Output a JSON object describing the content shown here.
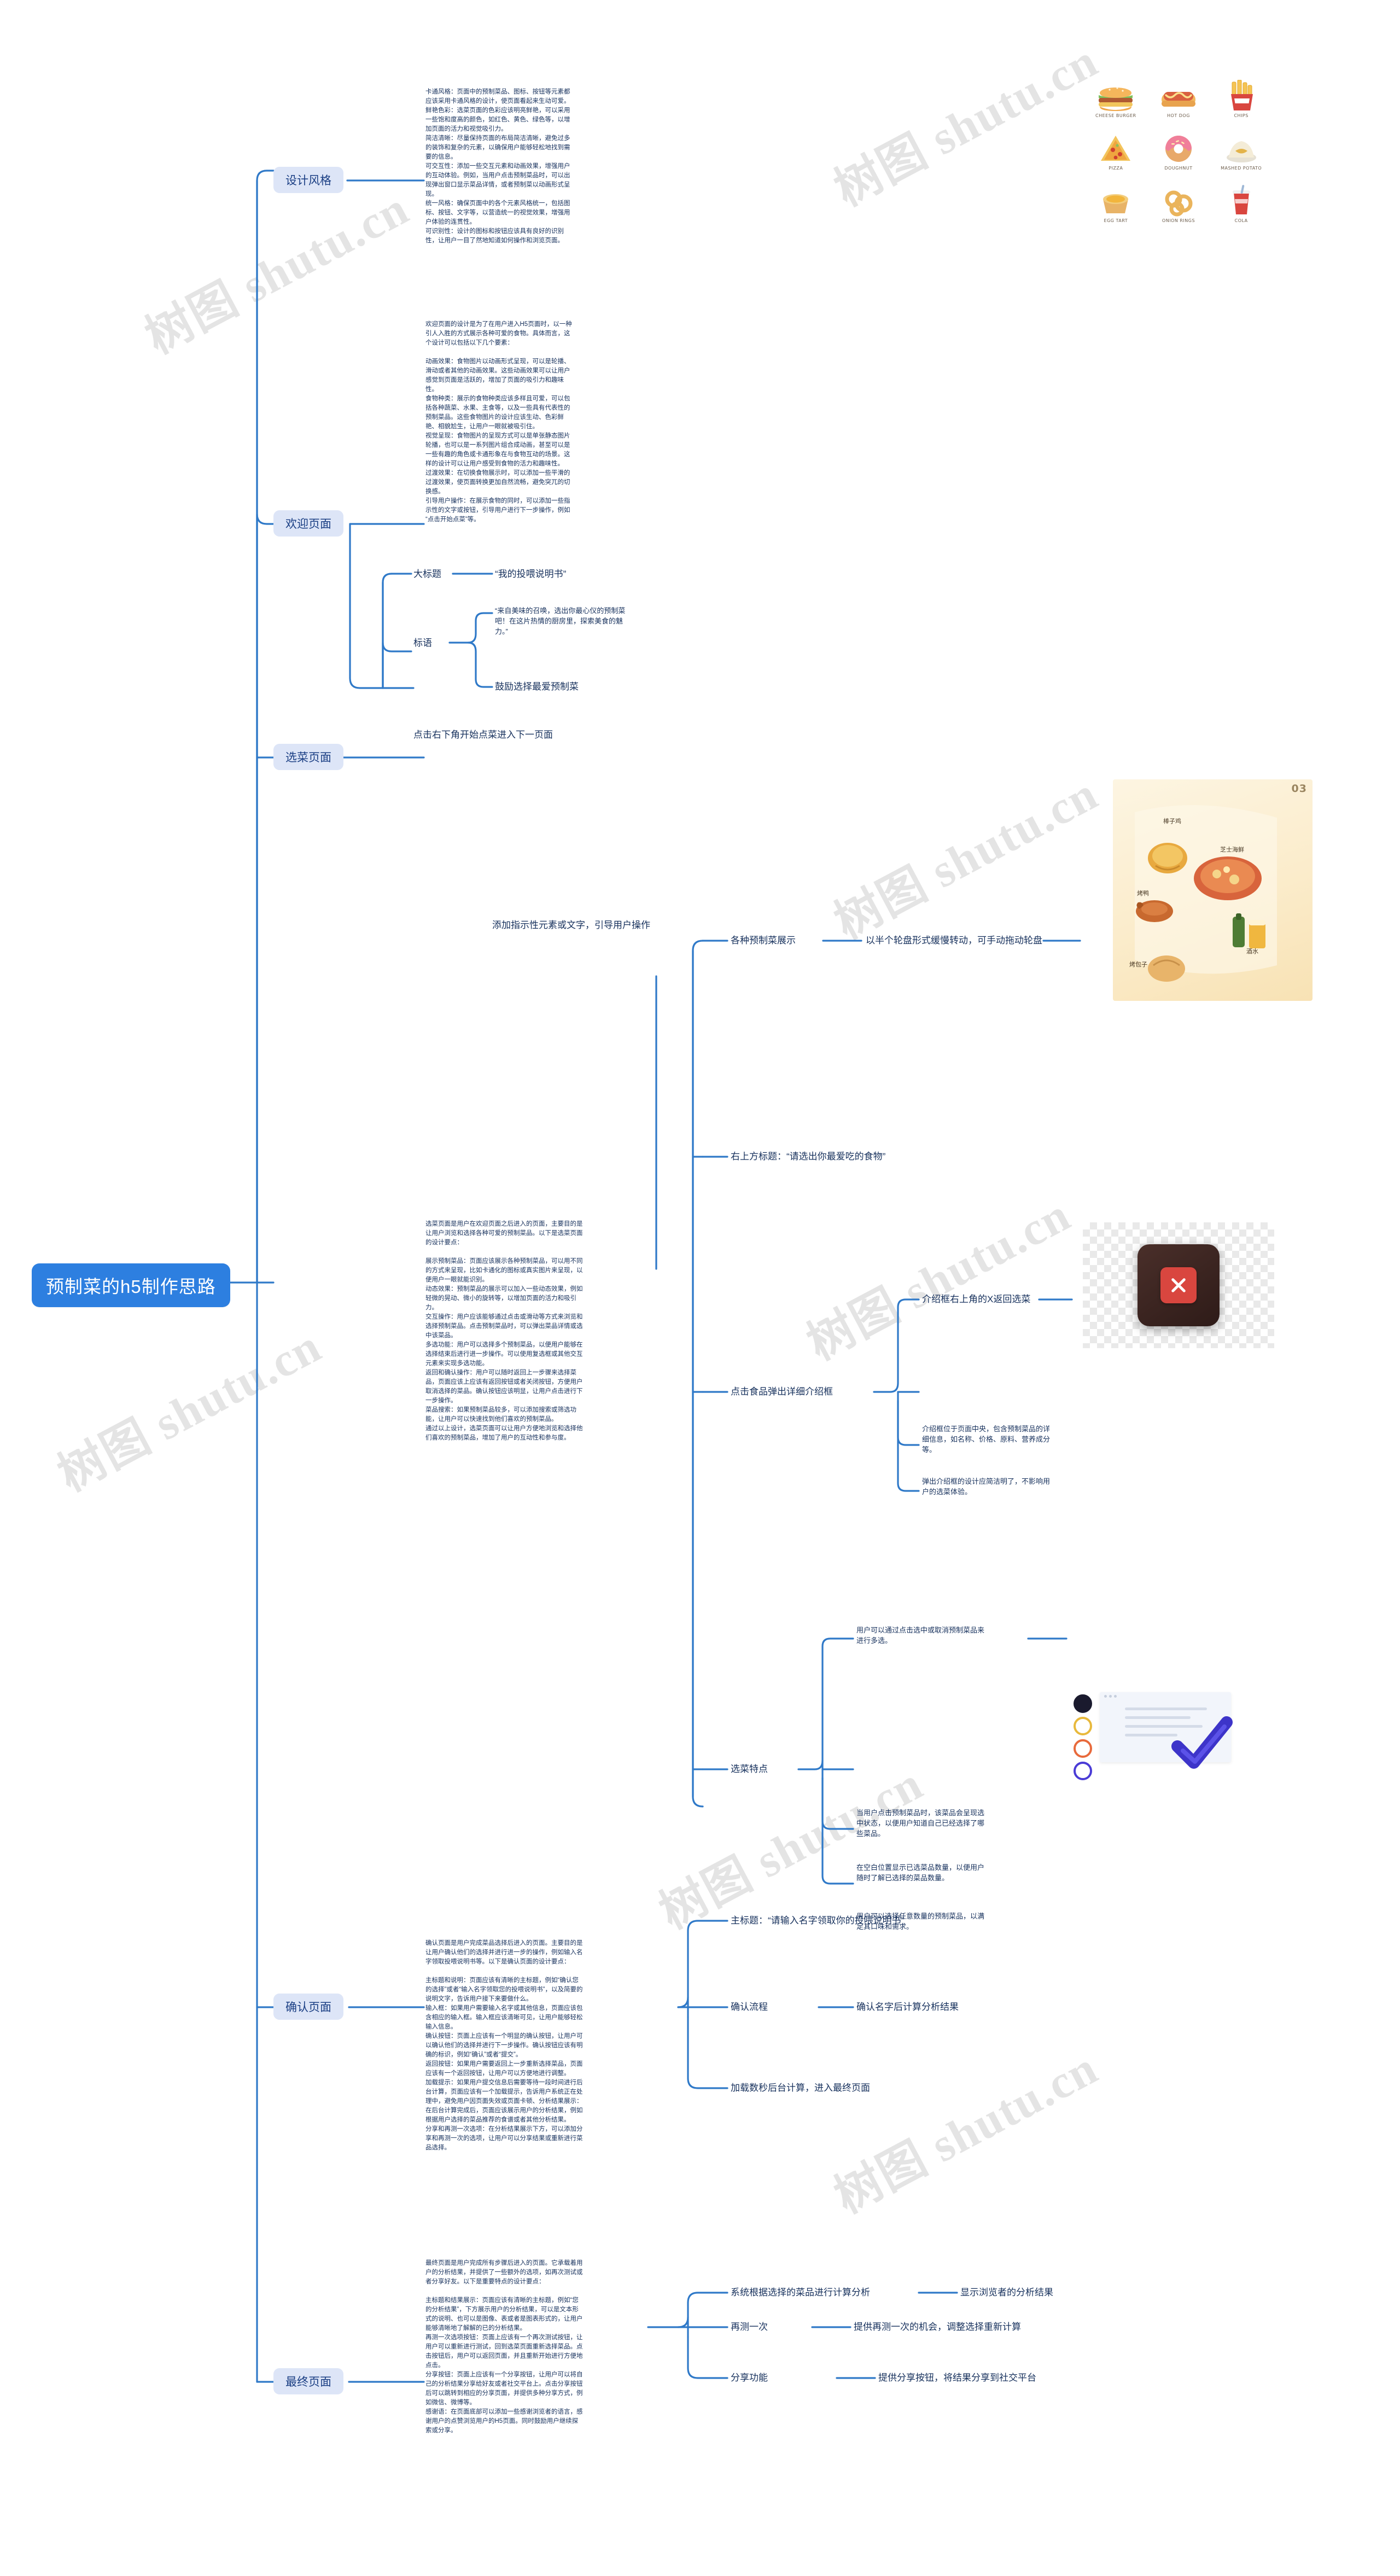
{
  "root": {
    "title": "预制菜的h5制作思路"
  },
  "watermarks": [
    "树图 shutu.cn",
    "树图 shutu.cn",
    "树图 shutu.cn",
    "树图 shutu.cn",
    "树图 shutu.cn",
    "树图 shutu.cn",
    "树图 shutu.cn"
  ],
  "branches": {
    "design_style": {
      "label": "设计风格",
      "detail": "卡通风格：页面中的预制菜品、图标、按钮等元素都应该采用卡通风格的设计，使页面看起来生动可爱。\n鲜艳色彩：选菜页面的色彩应该明亮鲜艳，可以采用一些饱和度高的颜色，如红色、黄色、绿色等，以增加页面的活力和视觉吸引力。\n简洁清晰：尽量保持页面的布局简洁清晰，避免过多的装饰和复杂的元素，以确保用户能够轻松地找到需要的信息。\n可交互性：添加一些交互元素和动画效果，增强用户的互动体验。例如，当用户点击预制菜品时，可以出现弹出窗口显示菜品详情，或者预制菜以动画形式呈现。\n统一风格：确保页面中的各个元素风格统一，包括图标、按钮、文字等，以营造统一的视觉效果，增强用户体验的连贯性。\n可识别性：设计的图标和按钮应该具有良好的识别性，让用户一目了然地知道如何操作和浏览页面。"
    },
    "welcome_page": {
      "label": "欢迎页面",
      "detail": "欢迎页面的设计是为了在用户进入H5页面时，以一种引人入胜的方式展示各种可爱的食物。具体而言，这个设计可以包括以下几个要素：\n\n动画效果：食物图片以动画形式呈现，可以是轮播、滑动或者其他的动画效果。这些动画效果可以让用户感觉到页面是活跃的，增加了页面的吸引力和趣味性。\n食物种类：展示的食物种类应该多样且可爱，可以包括各种蔬菜、水果、主食等，以及一些具有代表性的预制菜品。这些食物图片的设计应该生动、色彩鲜艳、相貌尬生，让用户一眼就被吸引住。\n视觉呈现：食物图片的呈现方式可以是单张静态图片轮播，也可以是一系列图片组合成动画，甚至可以是一些有趣的角色或卡通形象在与食物互动的场景。这样的设计可以让用户感受到食物的活力和趣味性。\n过渡效果：在切换食物展示时，可以添加一些平滑的过渡效果，使页面转换更加自然流畅，避免突兀的切换感。\n引导用户操作：在展示食物的同时，可以添加一些指示性的文字或按钮，引导用户进行下一步操作，例如“点击开始点菜”等。",
      "children": [
        {
          "label": "大标题",
          "value": "“我的投喂说明书”"
        },
        {
          "label": "标语",
          "values": [
            "“来自美味的召唤，选出你最心仪的预制菜吧！在这片热情的厨房里，探索美食的魅力。”",
            "鼓励选择最爱预制菜"
          ]
        }
      ],
      "next_step": "点击右下角开始点菜进入下一页面"
    },
    "dish_page": {
      "label": "选菜页面",
      "detail": "选菜页面是用户在欢迎页面之后进入的页面，主要目的是让用户浏览和选择各种可爱的预制菜品。以下是选菜页面的设计要点：\n\n展示预制菜品：页面应该展示各种预制菜品，可以用不同的方式来呈现，比如卡通化的图标或真实图片来呈现，以便用户一眼就能识别。\n动态效果：预制菜品的展示可以加入一些动态效果，例如轻微的晃动、微小的旋转等，以增加页面的活力和吸引力。\n交互操作：用户应该能够通过点击或滑动等方式来浏览和选择预制菜品。点击预制菜品时，可以弹出菜品详情或选中该菜品。\n多选功能：用户可以选择多个预制菜品，以便用户能够在选择结束后进行进一步操作。可以使用复选框或其他交互元素来实现多选功能。\n返回和确认操作：用户可以随时返回上一步骤来选择菜品，页面应该上应该有返回按钮或者关闭按钮，方便用户取消选择的菜品。确认按钮应该明显，让用户点击进行下一步操作。\n菜品搜索：如果预制菜品较多，可以添加搜索或筛选功能，让用户可以快速找到他们喜欢的预制菜品。\n通过以上设计，选菜页面可以让用户方便地浏览和选择他们喜欢的预制菜品，增加了用户的互动性和参与度。",
      "hint": "添加指示性元素或文字，引导用户操作",
      "children": [
        {
          "label": "各种预制菜展示",
          "value": "以半个轮盘形式缓慢转动，可手动拖动轮盘"
        },
        {
          "label": "右上方标题：“请选出你最爱吃的食物”"
        },
        {
          "label": "点击食品弹出详细介绍框",
          "values": [
            "介绍框右上角的X返回选菜",
            "介绍框位于页面中央，包含预制菜品的详细信息，如名称、价格、原料、营养成分等。",
            "弹出介绍框的设计应简洁明了，不影响用户的选菜体验。"
          ]
        },
        {
          "label": "选菜特点",
          "values": [
            "用户可以通过点击选中或取消预制菜品来进行多选。",
            "当用户点击预制菜品时，该菜品会呈现选中状态，以便用户知道自己已经选择了哪些菜品。",
            "在空白位置显示已选菜品数量，以便用户随时了解已选择的菜品数量。",
            "用户可以选择任意数量的预制菜品，以满足其口味和需求。"
          ]
        }
      ]
    },
    "confirm_page": {
      "label": "确认页面",
      "detail": "确认页面是用户完成菜品选择后进入的页面。主要目的是让用户确认他们的选择并进行进一步的操作，例如输入名字领取投喂说明书等。以下是确认页面的设计要点：\n\n主标题和说明：页面应该有清晰的主标题，例如“确认您的选择”或者“输入名字领取您的投喂说明书”，以及简要的说明文字，告诉用户接下来要做什么。\n输入框：如果用户需要输入名字或其他信息，页面应该包含相应的输入框。输入框应该清晰可见，让用户能够轻松输入信息。\n确认按钮：页面上应该有一个明显的确认按钮，让用户可以确认他们的选择并进行下一步操作。确认按钮应该有明确的标识，例如“确认”或者“提交”。\n返回按钮：如果用户需要返回上一步重新选择菜品，页面应该有一个返回按钮，让用户可以方便地进行调整。\n加载提示：如果用户提交信息后需要等待一段时间进行后台计算，页面应该有一个加载提示，告诉用户系统正在处理中，避免用户因页面失效或页面卡顿、分析结果展示：在后台计算完成后，页面应该展示用户的分析结果，例如根据用户选择的菜品推荐的食谱或者其他分析结果。\n分享和再测一次选项：在分析结果展示下方，可以添加分享和再测一次的选项，让用户可以分享结果或重新进行菜品选择。",
      "children": [
        {
          "label": "主标题：“请输入名字领取你的投喂说明书”"
        },
        {
          "label": "确认流程",
          "value": "确认名字后计算分析结果"
        },
        {
          "label": "加载数秒后台计算，进入最终页面"
        }
      ]
    },
    "final_page": {
      "label": "最终页面",
      "detail": "最终页面是用户完成所有步骤后进入的页面。它承载着用户的分析结果，并提供了一些额外的选项，如再次测试或者分享好友。以下是重要特点的设计要点：\n\n主标题和结果展示：页面应该有清晰的主标题，例如“您的分析结果”，下方展示用户的分析结果，可以是文本形式的说明、也可以是图像、表或者是图表形式的，让用户能够清晰地了解解的已的分析结果。\n再测一次选项按钮：页面上应该有一个再次测试按钮，让用户可以重新进行测试，回到选菜页面重新选择菜品。点击按钮后，用户可以返回页面，并且重新开始进行方便地点击。\n分享按钮：页面上应该有一个分享按钮，让用户可以将自己的分析结果分享给好友或者社交平台上。点击分享按钮后可以跳转到相应的分享页面，并提供多种分享方式，例如微信、微博等。\n感谢语：在页面底部可以添加一些感谢浏览者的语言，感谢用户的点赞浏览用户的H5页面。同时鼓励用户继续探索或分享。",
      "children": [
        {
          "label": "系统根据选择的菜品进行计算分析",
          "value": "显示浏览者的分析结果"
        },
        {
          "label": "再测一次",
          "value": "提供再测一次的机会，调整选择重新计算"
        },
        {
          "label": "分享功能",
          "value": "提供分享按钮，将结果分享到社交平台"
        }
      ]
    }
  },
  "illustrations": {
    "food_grid": {
      "name": "cartoon-food-icons",
      "items": [
        {
          "caption": "CHEESE BURGER"
        },
        {
          "caption": "HOT DOG"
        },
        {
          "caption": "CHIPS"
        },
        {
          "caption": "PIZZA"
        },
        {
          "caption": "DOUGHNUT"
        },
        {
          "caption": "MASHED POTATO"
        },
        {
          "caption": "EGG TART"
        },
        {
          "caption": "ONION RINGS"
        },
        {
          "caption": "COLA"
        }
      ]
    },
    "dish_wheel": {
      "name": "dish-wheel-illustration",
      "badge": "03",
      "labels": [
        "棒子鸡",
        "芝士海鲜",
        "烤鸭",
        "酒水",
        "烤包子"
      ]
    },
    "close_dialog": {
      "name": "close-dialog-illustration"
    },
    "result_check": {
      "name": "analysis-result-illustration"
    }
  }
}
